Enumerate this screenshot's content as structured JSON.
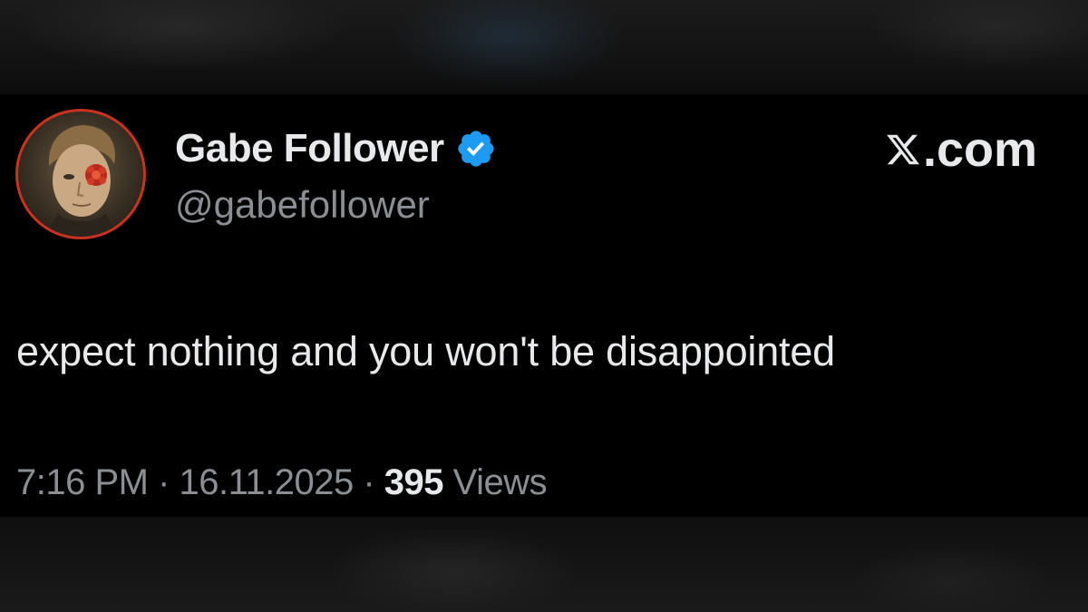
{
  "brand": {
    "label": ".com",
    "icon": "x-logo-icon"
  },
  "author": {
    "display_name": "Gabe Follower",
    "handle": "@gabefollower",
    "verified": true,
    "verified_icon": "verified-badge-icon",
    "verified_color": "#1d9bf0",
    "avatar_ring_color": "#c8321e"
  },
  "post": {
    "text": "expect nothing and you won't be disappointed"
  },
  "meta": {
    "time": "7:16 PM",
    "separator": " · ",
    "date": "16.11.2025",
    "views_count": "395",
    "views_label": " Views"
  }
}
